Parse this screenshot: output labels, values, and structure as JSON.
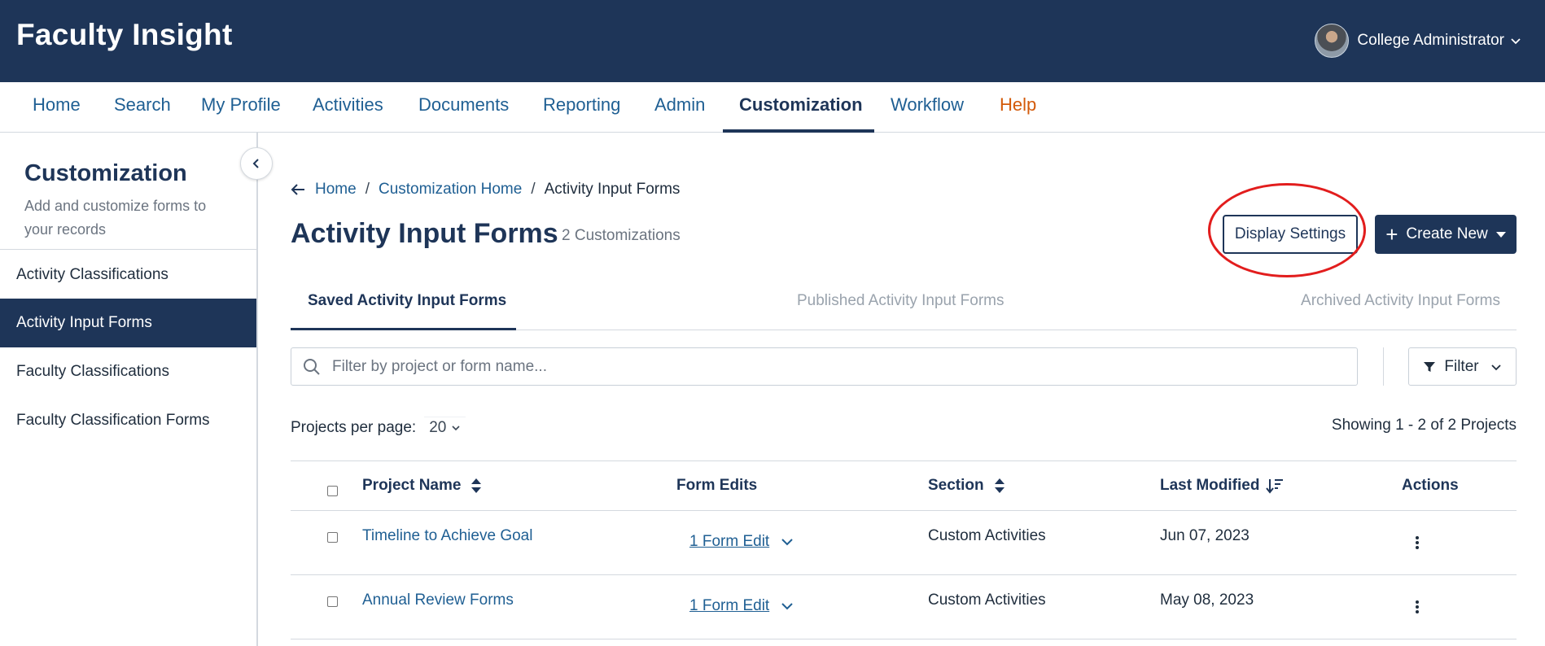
{
  "header": {
    "app_title": "Faculty Insight",
    "user_role": "College Administrator"
  },
  "nav": {
    "items": [
      {
        "label": "Home"
      },
      {
        "label": "Search"
      },
      {
        "label": "My Profile"
      },
      {
        "label": "Activities"
      },
      {
        "label": "Documents"
      },
      {
        "label": "Reporting"
      },
      {
        "label": "Admin"
      },
      {
        "label": "Customization",
        "active": true
      },
      {
        "label": "Workflow"
      },
      {
        "label": "Help"
      }
    ]
  },
  "sidebar": {
    "title": "Customization",
    "description": "Add and customize forms to your records",
    "items": [
      {
        "label": "Activity Classifications"
      },
      {
        "label": "Activity Input Forms",
        "active": true
      },
      {
        "label": "Faculty Classifications"
      },
      {
        "label": "Faculty Classification Forms"
      }
    ]
  },
  "breadcrumb": {
    "home": "Home",
    "parent": "Customization Home",
    "current": "Activity Input Forms",
    "separator": "/"
  },
  "page": {
    "title": "Activity Input Forms",
    "count": "2 Customizations"
  },
  "buttons": {
    "display_settings": "Display Settings",
    "create_new": "Create New",
    "filter": "Filter"
  },
  "tabs": [
    {
      "label": "Saved Activity Input Forms",
      "active": true
    },
    {
      "label": "Published Activity Input Forms"
    },
    {
      "label": "Archived Activity Input Forms"
    }
  ],
  "search": {
    "placeholder": "Filter by project or form name...",
    "value": ""
  },
  "pagination": {
    "per_page_label": "Projects per page:",
    "per_page_value": "20",
    "showing": "Showing 1 - 2 of 2 Projects"
  },
  "table": {
    "columns": [
      "Project Name",
      "Form Edits",
      "Section",
      "Last Modified",
      "Actions"
    ],
    "rows": [
      {
        "project_name": "Timeline to Achieve Goal",
        "form_edits": "1 Form Edit",
        "section": "Custom Activities",
        "last_modified": "Jun 07, 2023"
      },
      {
        "project_name": "Annual Review Forms",
        "form_edits": "1 Form Edit",
        "section": "Custom Activities",
        "last_modified": "May 08, 2023"
      }
    ]
  },
  "colors": {
    "primary": "#1e3558",
    "link": "#1f5f93",
    "help": "#d35a0a",
    "highlight": "#e21d1d"
  },
  "icons": [
    "chevron-down-icon",
    "chevron-left-icon",
    "arrow-left-icon",
    "plus-icon",
    "search-icon",
    "filter-icon",
    "sort-icon",
    "sort-desc-icon",
    "kebab-icon"
  ]
}
